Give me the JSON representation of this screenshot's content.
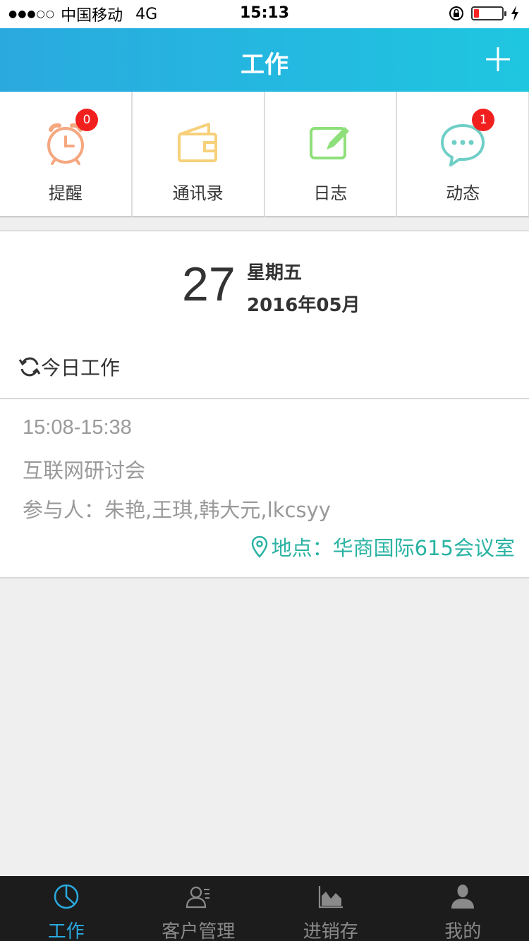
{
  "status_bar": {
    "signal": "●●●○○",
    "carrier": "中国移动",
    "network": "4G",
    "time": "15:13"
  },
  "nav": {
    "title": "工作"
  },
  "quick_items": [
    {
      "label": "提醒",
      "icon": "alarm-clock-icon",
      "badge": "0",
      "color": "#f5a77f"
    },
    {
      "label": "通讯录",
      "icon": "wallet-icon",
      "badge": null,
      "color": "#f7d07a"
    },
    {
      "label": "日志",
      "icon": "edit-note-icon",
      "badge": null,
      "color": "#8ee07a"
    },
    {
      "label": "动态",
      "icon": "chat-bubble-icon",
      "badge": "1",
      "color": "#6fcfc6"
    }
  ],
  "date": {
    "day": "27",
    "weekday": "星期五",
    "year_month": "2016年05月",
    "refresh_label": "今日工作"
  },
  "event": {
    "time": "15:08-15:38",
    "title": "互联网研讨会",
    "participants": "参与人：朱艳,王琪,韩大元,lkcsyy",
    "location": "地点：华商国际615会议室"
  },
  "tabs": [
    {
      "label": "工作",
      "icon": "pie-chart-icon",
      "active": true
    },
    {
      "label": "客户管理",
      "icon": "contact-card-icon",
      "active": false
    },
    {
      "label": "进销存",
      "icon": "area-chart-icon",
      "active": false
    },
    {
      "label": "我的",
      "icon": "person-icon",
      "active": false
    }
  ],
  "colors": {
    "accent": "#2aa9df",
    "badge": "#f21f1f",
    "location": "#2ab3a3"
  }
}
